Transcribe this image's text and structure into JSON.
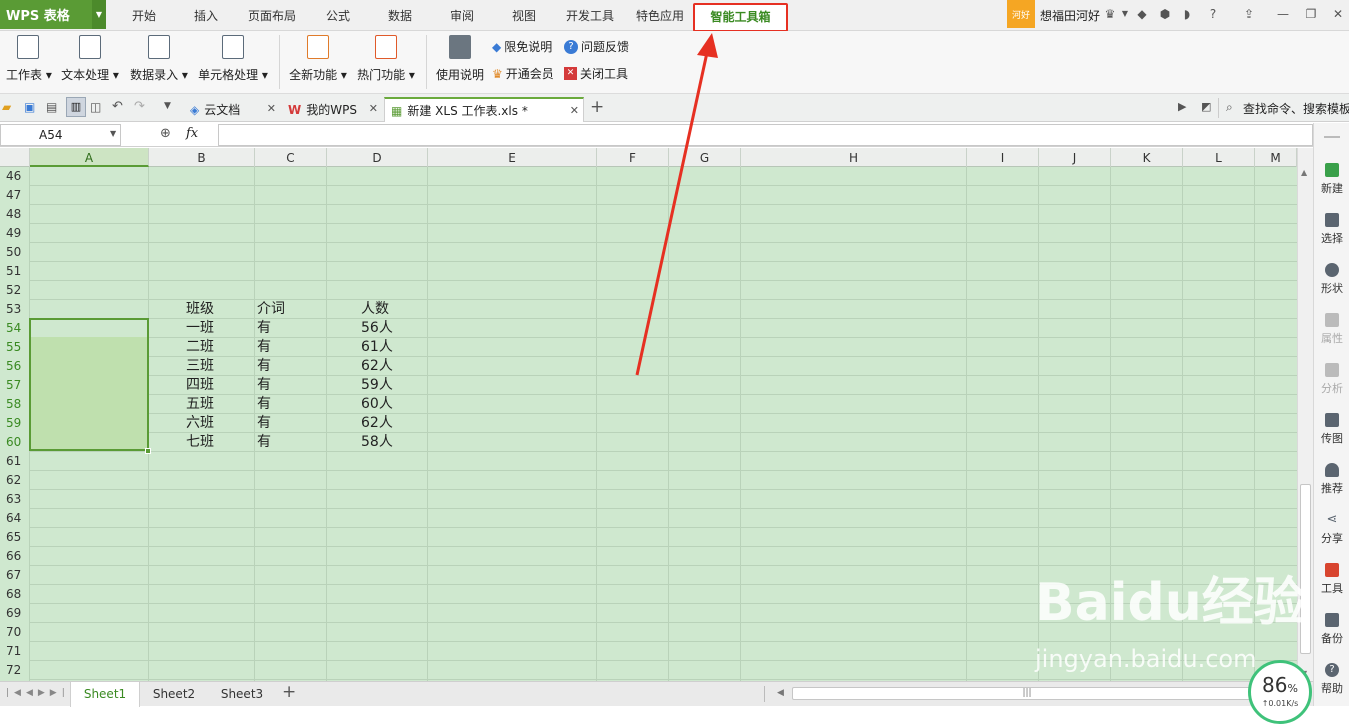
{
  "app": {
    "logo_label": "WPS 表格"
  },
  "menu_tabs": [
    "开始",
    "插入",
    "页面布局",
    "公式",
    "数据",
    "审阅",
    "视图",
    "开发工具",
    "特色应用",
    "智能工具箱"
  ],
  "user": {
    "badge": "河好",
    "name": "想福田河好"
  },
  "ribbon": {
    "buttons": [
      "工作表",
      "文本处理",
      "数据录入",
      "单元格处理",
      "全新功能",
      "热门功能",
      "使用说明"
    ],
    "small": {
      "limit": "限免说明",
      "feedback": "问题反馈",
      "member": "开通会员",
      "close_tool": "关闭工具"
    }
  },
  "doc_tabs": [
    {
      "label": "云文档"
    },
    {
      "label": "我的WPS"
    },
    {
      "label": "新建 XLS 工作表.xls *"
    }
  ],
  "search": {
    "placeholder": "查找命令、搜索模板"
  },
  "formula_bar": {
    "name_box": "A54",
    "fx": "fx",
    "value": ""
  },
  "columns": [
    "A",
    "B",
    "C",
    "D",
    "E",
    "F",
    "G",
    "H",
    "I",
    "J",
    "K",
    "L",
    "M"
  ],
  "rows": [
    "46",
    "47",
    "48",
    "49",
    "50",
    "51",
    "52",
    "53",
    "54",
    "55",
    "56",
    "57",
    "58",
    "59",
    "60",
    "61",
    "62",
    "63",
    "64",
    "65",
    "66",
    "67",
    "68",
    "69",
    "70",
    "71",
    "72"
  ],
  "table": {
    "headers": [
      "班级",
      "介词",
      "人数"
    ],
    "rows": [
      [
        "一班",
        "有",
        "56人"
      ],
      [
        "二班",
        "有",
        "61人"
      ],
      [
        "三班",
        "有",
        "62人"
      ],
      [
        "四班",
        "有",
        "59人"
      ],
      [
        "五班",
        "有",
        "60人"
      ],
      [
        "六班",
        "有",
        "62人"
      ],
      [
        "七班",
        "有",
        "58人"
      ]
    ]
  },
  "sidebar": [
    "新建",
    "选择",
    "形状",
    "属性",
    "分析",
    "传图",
    "推荐",
    "分享",
    "工具",
    "备份",
    "帮助"
  ],
  "sheets": [
    "Sheet1",
    "Sheet2",
    "Sheet3"
  ],
  "net_speed": {
    "percent": "86",
    "unit": "%",
    "rate": "↑0.01K/s"
  },
  "watermark": {
    "text": "Baidu经验",
    "url": "jingyan.baidu.com"
  },
  "colors": {
    "accent": "#5a9b35",
    "highlight": "#e63022",
    "grid_bg": "#cfe8cf"
  }
}
